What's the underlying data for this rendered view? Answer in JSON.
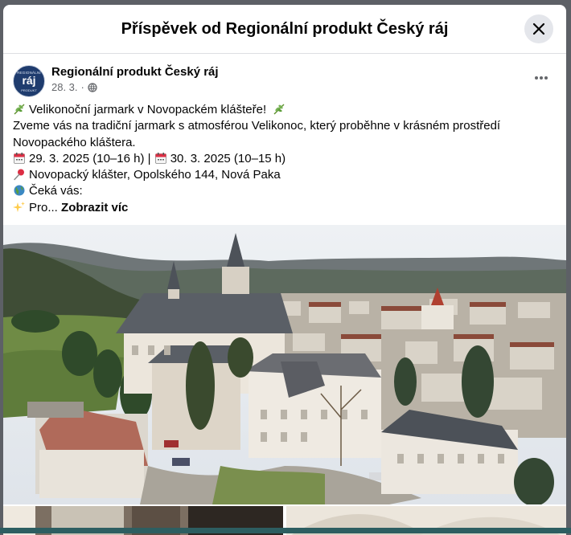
{
  "dialog": {
    "title": "Příspěvek od Regionální produkt Český ráj"
  },
  "post": {
    "author": "Regionální produkt Český ráj",
    "date": "28. 3.",
    "avatar": {
      "top": "REGIONÁLNÍ",
      "mid": "ráj",
      "bot": "PRODUKT"
    },
    "lines": {
      "l1": "Velikonoční jarmark v Novopackém klášteře!",
      "l2": "Zveme vás na tradiční jarmark s atmosférou Velikonoc, který proběhne v krásném prostředí",
      "l3": "Novopackého kláštera.",
      "l4a": "29. 3. 2025 (10–16 h) |",
      "l4b": "30. 3. 2025 (10–15 h)",
      "l5": "Novopacký klášter, Opolského 144, Nová Paka",
      "l6": "Čeká vás:",
      "l7": "Pro...",
      "see_more": "Zobrazit víc"
    }
  },
  "icons": {
    "close": "close-icon",
    "globe": "globe-icon",
    "more": "more-options-icon",
    "leaf": "herb-emoji",
    "calendar": "calendar-emoji",
    "pin": "pushpin-emoji",
    "globe_emoji": "globe-emoji",
    "sparkles": "sparkles-emoji"
  },
  "colors": {
    "brand_blue": "#1f3c6e",
    "secondary_text": "#65676b",
    "close_bg": "#e4e6eb"
  }
}
